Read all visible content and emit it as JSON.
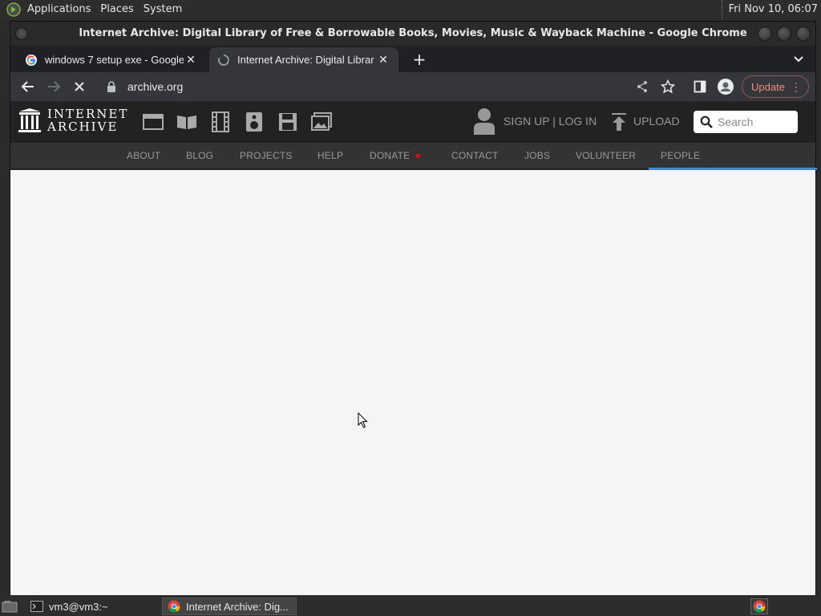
{
  "top_panel": {
    "menus": [
      "Applications",
      "Places",
      "System"
    ],
    "clock": "Fri Nov 10, 06:07"
  },
  "window": {
    "title": "Internet Archive: Digital Library of Free & Borrowable Books, Movies, Music & Wayback Machine - Google Chrome"
  },
  "tabs": [
    {
      "title": "windows 7 setup exe - Google",
      "state": "inactive",
      "icon": "google-g-icon"
    },
    {
      "title": "Internet Archive: Digital Librar",
      "state": "active-loading",
      "icon": "loading-spinner-icon"
    }
  ],
  "toolbar": {
    "url": "archive.org",
    "update_label": "Update"
  },
  "ia": {
    "logo_line1": "INTERNET",
    "logo_line2": "ARCHIVE",
    "signin_label": "SIGN UP | LOG IN",
    "upload_label": "UPLOAD",
    "search_placeholder": "Search",
    "nav": [
      "ABOUT",
      "BLOG",
      "PROJECTS",
      "HELP",
      "DONATE",
      "CONTACT",
      "JOBS",
      "VOLUNTEER",
      "PEOPLE"
    ],
    "active_nav": "PEOPLE",
    "donate_heart_color": "#ff0100"
  },
  "taskbar": {
    "items": [
      "vm3@vm3:~",
      "Internet Archive: Dig..."
    ]
  },
  "colors": {
    "nav_active_bar": "#428bca",
    "update_text": "#f28b82",
    "content_bg": "#f5f5f7"
  }
}
